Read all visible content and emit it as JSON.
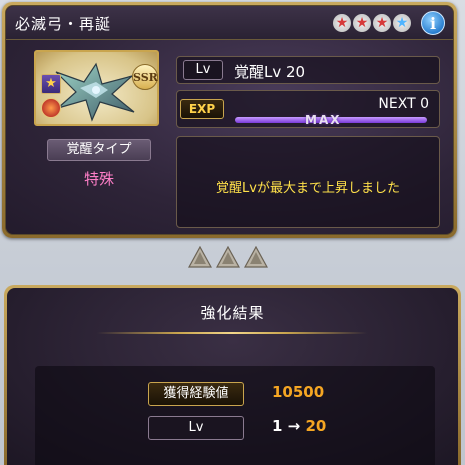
{
  "weapon": {
    "name": "必滅弓・再誕",
    "rarity_badge": "SSR",
    "stars": [
      {
        "icon": "star-red-icon",
        "color": "#d63a3a"
      },
      {
        "icon": "star-red-icon",
        "color": "#d63a3a"
      },
      {
        "icon": "star-red-icon",
        "color": "#d63a3a"
      },
      {
        "icon": "star-blue-icon",
        "color": "#4fb4ff"
      }
    ],
    "info_icon": "i"
  },
  "awakening": {
    "type_label": "覚醒タイプ",
    "type_value": "特殊"
  },
  "level": {
    "tag": "Lv",
    "value": "覚醒Lv 20"
  },
  "exp": {
    "tag": "EXP",
    "next": "NEXT 0",
    "bar_label": "MAX",
    "progress": 1.0
  },
  "message": "覚醒Lvが最大まで上昇しました",
  "results": {
    "title": "強化結果",
    "exp_label": "獲得経験値",
    "exp_value": "10500",
    "lv_label": "Lv",
    "lv_from": "1",
    "arrow": "→",
    "lv_to": "20"
  }
}
